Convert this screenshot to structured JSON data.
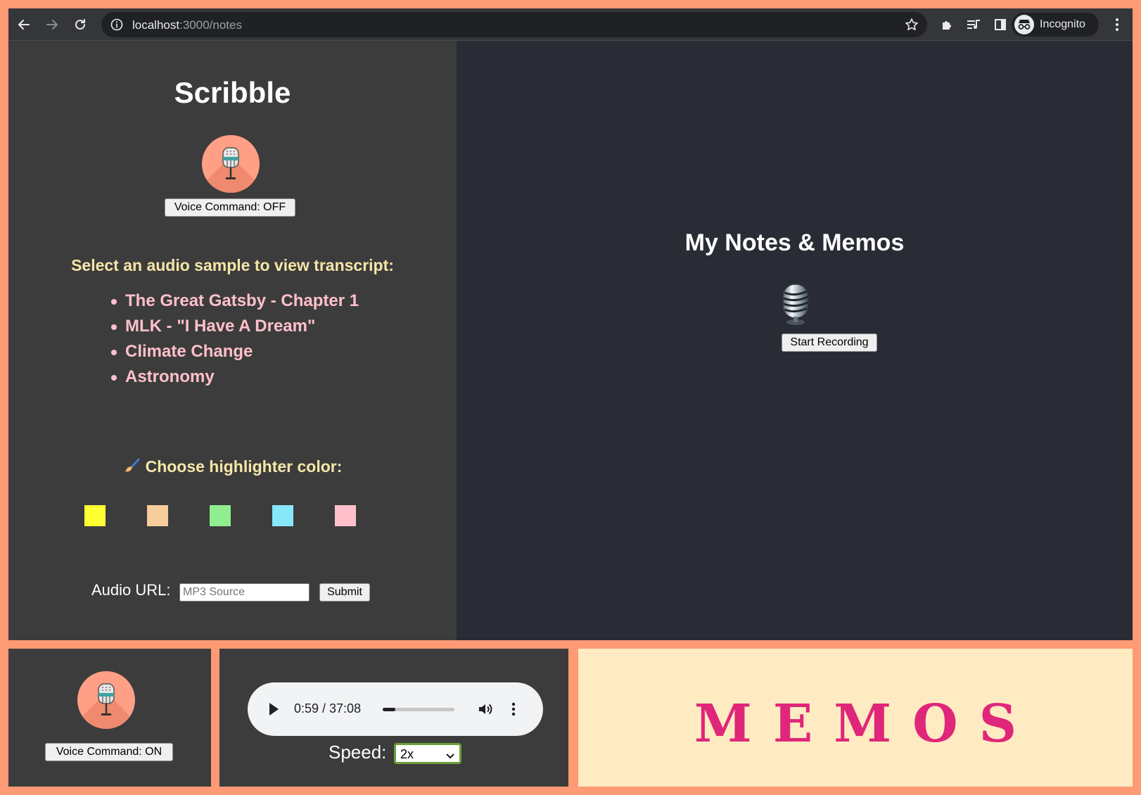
{
  "browser": {
    "url_host": "localhost",
    "url_path": ":3000/notes",
    "profile_label": "Incognito"
  },
  "left": {
    "title": "Scribble",
    "voice_command_label": "Voice Command: OFF",
    "prompt": "Select an audio sample to view transcript:",
    "samples": [
      "The Great Gatsby - Chapter 1",
      "MLK - \"I Have A Dream\"",
      "Climate Change",
      "Astronomy"
    ],
    "highlighter_prompt": "Choose highlighter color:",
    "highlighter_colors": [
      "#ffff33",
      "#f7cd9c",
      "#90ee90",
      "#87e8fa",
      "#ffc0cb"
    ],
    "audio_url_label": "Audio URL:",
    "audio_url_placeholder": "MP3 Source",
    "submit_label": "Submit"
  },
  "right": {
    "title": "My Notes & Memos",
    "record_label": "Start Recording"
  },
  "widgets": {
    "voice_command_on_label": "Voice Command: ON",
    "player_time": "0:59 / 37:08",
    "player_progress": 0.027,
    "speed_label": "Speed:",
    "speed_value": "2x",
    "memos_text": "MEMOS"
  },
  "colors": {
    "background": "#fe9a74",
    "left_pane": "#3c3c3c",
    "right_pane": "#292c35",
    "title_yellow": "#f5e6a8",
    "link_pink": "#ffc0cb",
    "memos_magenta": "#e0267a",
    "memos_bg": "#ffebc2"
  },
  "icons": [
    "back-arrow-icon",
    "forward-arrow-icon",
    "reload-icon",
    "info-icon",
    "star-icon",
    "extensions-icon",
    "media-queue-icon",
    "side-panel-icon",
    "incognito-icon",
    "more-vert-icon",
    "microphone-icon",
    "paintbrush-icon",
    "studio-microphone-icon",
    "play-icon",
    "volume-icon"
  ]
}
